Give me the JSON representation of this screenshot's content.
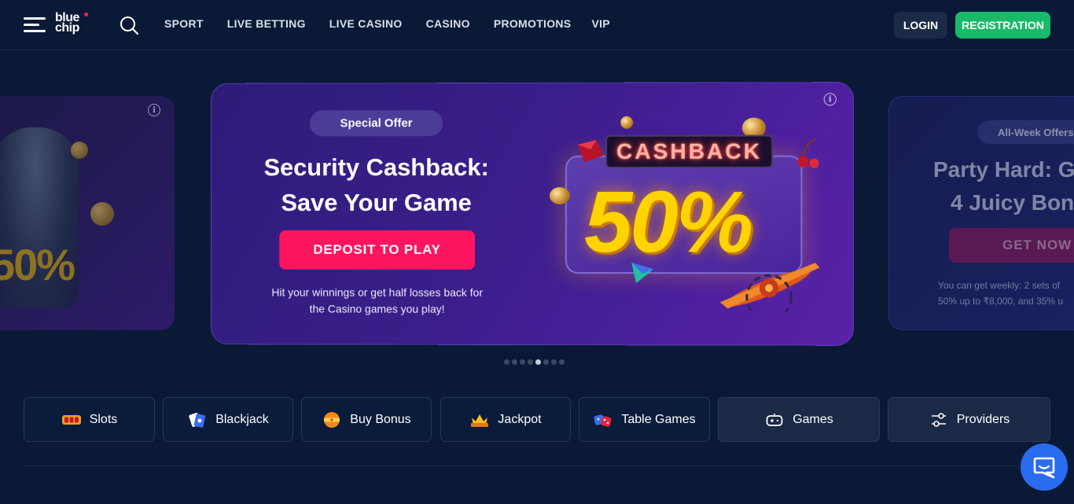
{
  "header": {
    "logo_line1": "blue",
    "logo_line2": "chip",
    "nav": [
      "SPORT",
      "LIVE BETTING",
      "LIVE CASINO",
      "CASINO",
      "PROMOTIONS",
      "VIP"
    ],
    "login_label": "LOGIN",
    "registration_label": "REGISTRATION"
  },
  "carousel": {
    "prev_slide": {
      "percent_text": "50%"
    },
    "current_slide": {
      "badge": "Special Offer",
      "title_line1": "Security Cashback:",
      "title_line2": "Save Your Game",
      "cta": "DEPOSIT TO PLAY",
      "description_line1": "Hit your winnings or get half losses back for",
      "description_line2": "the Casino games you play!",
      "art_sign": "CASHBACK",
      "art_percent": "50%",
      "info_icon": "info-icon"
    },
    "next_slide": {
      "badge": "All-Week Offers",
      "title_line1": "Party Hard: G",
      "title_line2": "4 Juicy Bon",
      "cta": "GET NOW",
      "description_line1": "You can get weekly: 2 sets of",
      "description_line2": "50% up to ₹8,000, and 35% u"
    },
    "dot_count": 8,
    "active_dot_index": 4
  },
  "categories": [
    {
      "label": "Slots",
      "icon": "slots-icon"
    },
    {
      "label": "Blackjack",
      "icon": "blackjack-cards-icon"
    },
    {
      "label": "Buy Bonus",
      "icon": "buy-bonus-icon"
    },
    {
      "label": "Jackpot",
      "icon": "jackpot-crown-icon"
    },
    {
      "label": "Table Games",
      "icon": "dice-icon"
    },
    {
      "label": "Games",
      "icon": "gamepad-icon"
    },
    {
      "label": "Providers",
      "icon": "sliders-icon"
    }
  ],
  "colors": {
    "background": "#0a1a36",
    "registration": "#19b96a",
    "deposit_cta": "#ff1460",
    "chat": "#2a6cf0"
  }
}
